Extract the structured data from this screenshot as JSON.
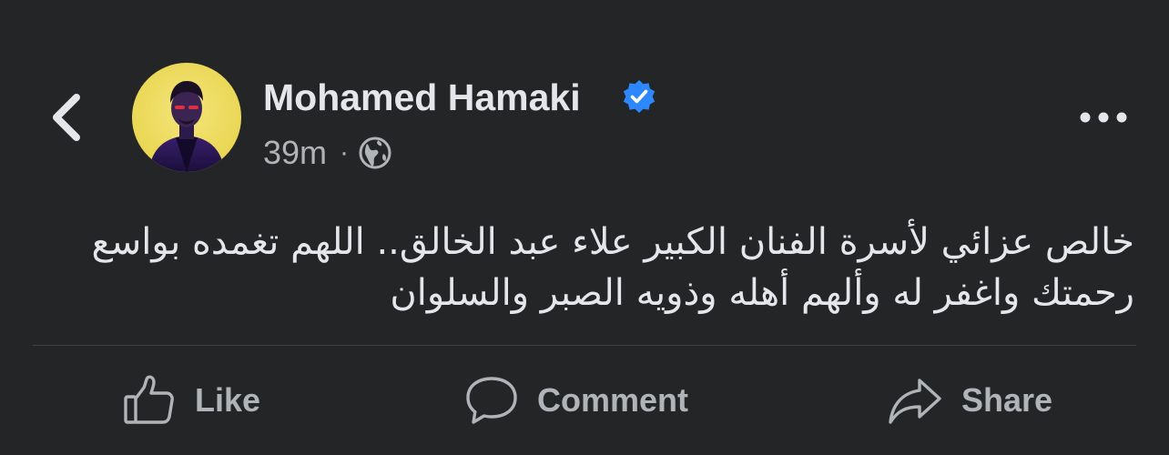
{
  "header": {
    "back_icon": "chevron-left-icon",
    "author_name": "Mohamed Hamaki",
    "verified_icon": "verified-badge-icon",
    "timestamp": "39m",
    "separator": "·",
    "privacy_icon": "globe-icon",
    "more_icon": "more-horizontal-icon"
  },
  "post": {
    "text_line_1": "خالص عزائي لأسرة الفنان الكبير علاء عبد الخالق.. اللهم تغمده بواسع",
    "text_line_2": "رحمتك واغفر له وألهم أهله وذويه الصبر والسلوان"
  },
  "actions": {
    "like_label": "Like",
    "comment_label": "Comment",
    "share_label": "Share"
  },
  "colors": {
    "background": "#242526",
    "primary_text": "#e4e6eb",
    "secondary_text": "#b0b3b8",
    "verified_blue": "#2d88ff",
    "divider": "#3e4042"
  }
}
